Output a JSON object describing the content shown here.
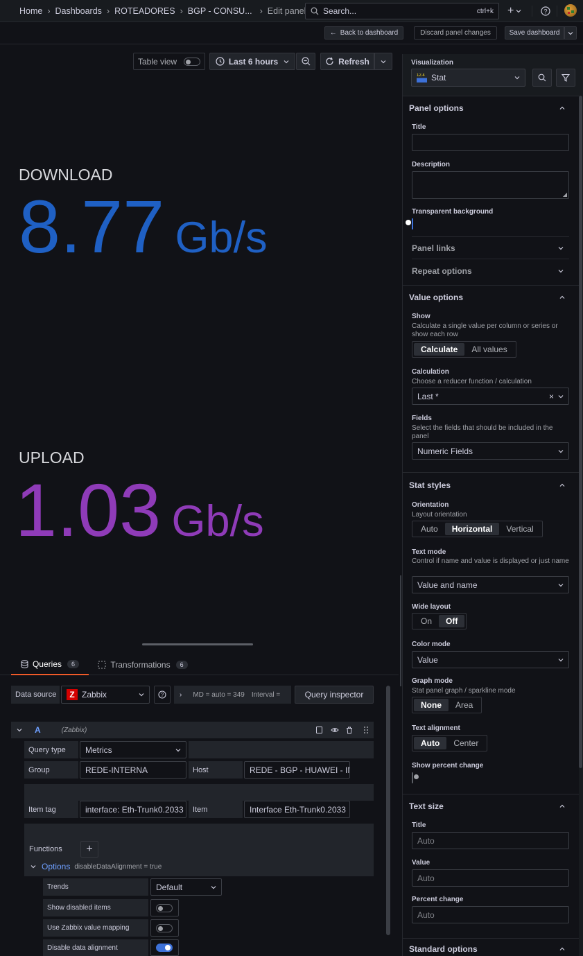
{
  "topbar": {
    "breadcrumbs": [
      "Home",
      "Dashboards",
      "ROTEADORES",
      "BGP - CONSU...",
      "Edit panel"
    ],
    "search_placeholder": "Search...",
    "search_shortcut": "ctrl+k"
  },
  "toolbar": {
    "back": "Back to dashboard",
    "discard": "Discard panel changes",
    "save": "Save dashboard"
  },
  "panel_toolbar": {
    "table_view": "Table view",
    "time_range": "Last 6 hours",
    "refresh": "Refresh"
  },
  "stats": [
    {
      "name": "DOWNLOAD",
      "value": "8.77",
      "unit": "Gb/s",
      "color": "#1f60c4"
    },
    {
      "name": "UPLOAD",
      "value": "1.03",
      "unit": "Gb/s",
      "color": "#8f3bb8"
    }
  ],
  "tabs": {
    "queries": "Queries",
    "queries_count": "6",
    "transformations": "Transformations",
    "transformations_count": "6"
  },
  "query": {
    "datasource_label": "Data source",
    "datasource": "Zabbix",
    "meta": "MD = auto = 349",
    "interval": "Interval =",
    "inspector": "Query inspector",
    "ref": "A",
    "ref_ds": "(Zabbix)",
    "query_type_label": "Query type",
    "query_type": "Metrics",
    "group_label": "Group",
    "group": "REDE-INTERNA",
    "host_label": "Host",
    "host": "REDE - BGP - HUAWEI - IN",
    "item_tag_label": "Item tag",
    "item_tag": "interface: Eth-Trunk0.2033",
    "item_label": "Item",
    "item": "Interface Eth-Trunk0.2033",
    "functions_label": "Functions",
    "options_label": "Options",
    "options_summary": "disableDataAlignment = true",
    "trends_label": "Trends",
    "trends": "Default",
    "show_disabled_label": "Show disabled items",
    "value_mapping_label": "Use Zabbix value mapping",
    "disable_alignment_label": "Disable data alignment"
  },
  "options": {
    "visualization_label": "Visualization",
    "visualization": "Stat",
    "viz_icon_text": "12.4",
    "panel_options": "Panel options",
    "title_label": "Title",
    "title_value": "",
    "description_label": "Description",
    "transparent_label": "Transparent background",
    "panel_links": "Panel links",
    "repeat_options": "Repeat options",
    "value_options": "Value options",
    "show_label": "Show",
    "show_desc": "Calculate a single value per column or series or show each row",
    "show_opts": [
      "Calculate",
      "All values"
    ],
    "calc_label": "Calculation",
    "calc_desc": "Choose a reducer function / calculation",
    "calc_value": "Last *",
    "fields_label": "Fields",
    "fields_desc": "Select the fields that should be included in the panel",
    "fields_value": "Numeric Fields",
    "stat_styles": "Stat styles",
    "orientation_label": "Orientation",
    "orientation_desc": "Layout orientation",
    "orientation_opts": [
      "Auto",
      "Horizontal",
      "Vertical"
    ],
    "text_mode_label": "Text mode",
    "text_mode_desc": "Control if name and value is displayed or just name",
    "text_mode_value": "Value and name",
    "wide_layout_label": "Wide layout",
    "wide_opts": [
      "On",
      "Off"
    ],
    "color_mode_label": "Color mode",
    "color_mode_value": "Value",
    "graph_mode_label": "Graph mode",
    "graph_mode_desc": "Stat panel graph / sparkline mode",
    "graph_opts": [
      "None",
      "Area"
    ],
    "text_align_label": "Text alignment",
    "align_opts": [
      "Auto",
      "Center"
    ],
    "percent_change_label": "Show percent change",
    "text_size": "Text size",
    "ts_title_label": "Title",
    "ts_value_label": "Value",
    "ts_percent_label": "Percent change",
    "auto_placeholder": "Auto",
    "standard_options": "Standard options"
  }
}
